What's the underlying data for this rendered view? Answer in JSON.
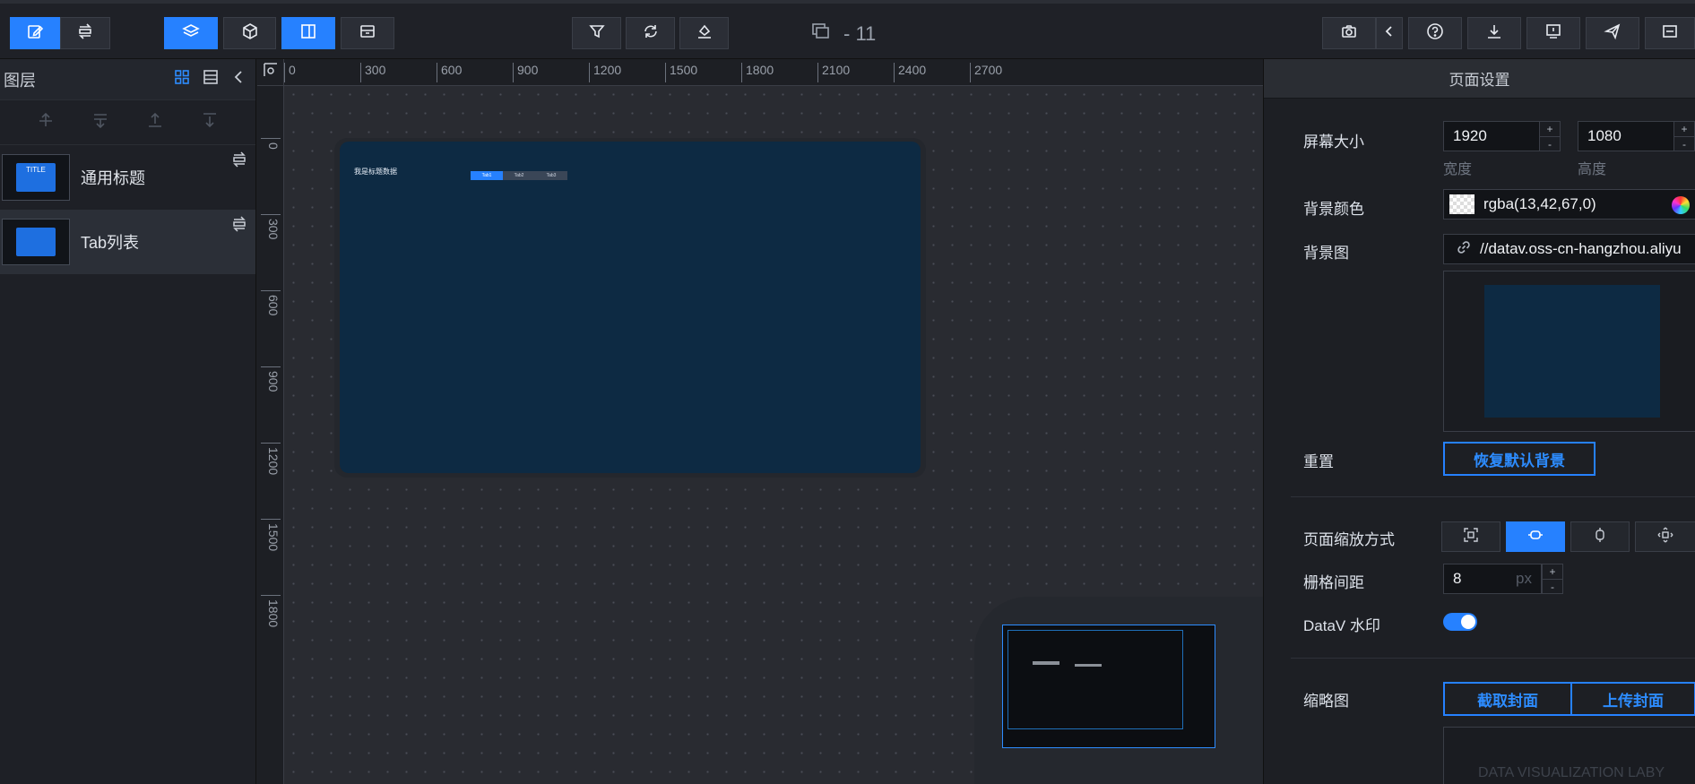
{
  "toolbar": {
    "left_group": [
      "edit-icon",
      "layer-swap-icon"
    ],
    "mid_group": [
      "layers-icon",
      "cube-icon",
      "panel-icon",
      "box-icon"
    ],
    "center_group": [
      "filter-icon",
      "refresh-icon",
      "paint-icon"
    ],
    "right_group": [
      "camera-icon",
      "chevron-left-icon",
      "help-icon",
      "download-icon",
      "alert-icon",
      "send-icon",
      "menu-icon"
    ],
    "page_counter": "- 11"
  },
  "layers": {
    "title": "图层",
    "items": [
      {
        "name": "通用标题",
        "thumb_text": "TITLE",
        "selected": false
      },
      {
        "name": "Tab列表",
        "thumb_text": "",
        "selected": true
      }
    ]
  },
  "ruler": {
    "h_ticks": [
      "0",
      "300",
      "600",
      "900",
      "1200",
      "1500",
      "1800",
      "2100",
      "2400",
      "2700"
    ],
    "v_ticks": [
      "0",
      "300",
      "600",
      "900",
      "1200",
      "1500",
      "1800"
    ]
  },
  "stage": {
    "title_text": "我是标题数据",
    "tabs": [
      "Tab1",
      "Tab2",
      "Tab3"
    ],
    "color": "#0d2a43"
  },
  "settings": {
    "header": "页面设置",
    "screen_size_label": "屏幕大小",
    "width_value": "1920",
    "height_value": "1080",
    "width_sublabel": "宽度",
    "height_sublabel": "高度",
    "bg_color_label": "背景颜色",
    "bg_color_value": "rgba(13,42,67,0)",
    "bg_image_label": "背景图",
    "bg_image_value": "//datav.oss-cn-hangzhou.aliyu",
    "reset_label": "重置",
    "reset_button": "恢复默认背景",
    "scale_label": "页面缩放方式",
    "grid_label": "栅格间距",
    "grid_value": "8",
    "grid_unit": "px",
    "watermark_label": "DataV 水印",
    "watermark_on": true,
    "thumb_label": "缩略图",
    "capture_button": "截取封面",
    "upload_button": "上传封面",
    "thumb_watermark": "DATA VISUALIZATION LABY"
  },
  "colors": {
    "accent": "#2681ff",
    "panel": "#1d1f24",
    "canvas": "#292b31"
  }
}
